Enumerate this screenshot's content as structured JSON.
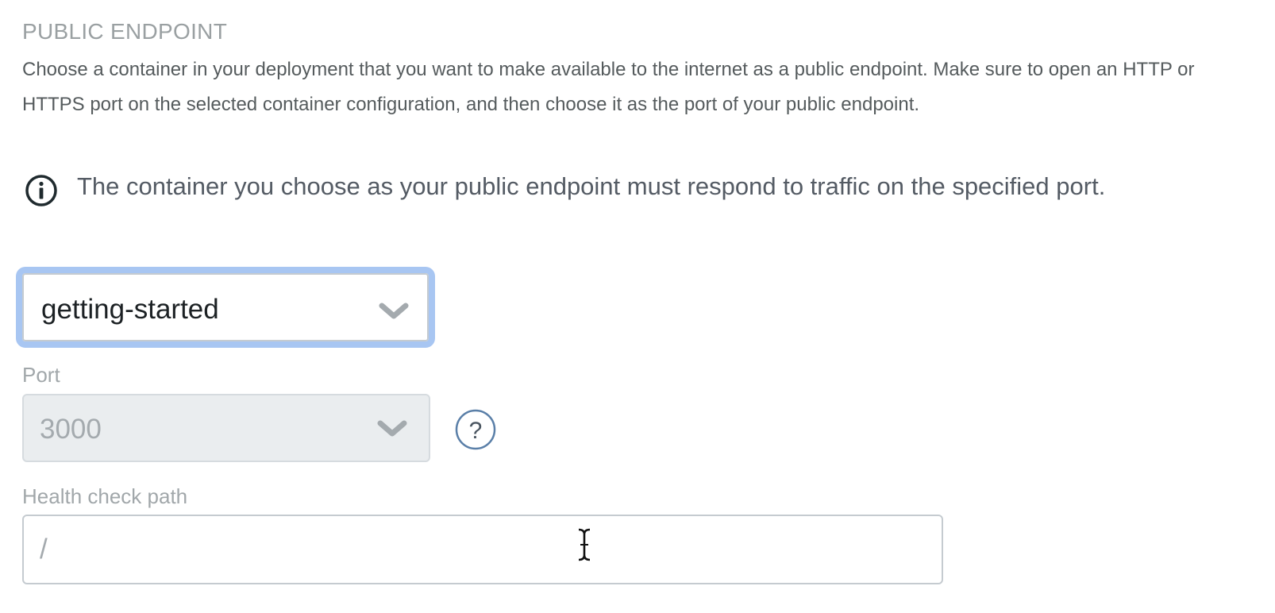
{
  "public_endpoint": {
    "heading": "PUBLIC ENDPOINT",
    "description": "Choose a container in your deployment that you want to make available to the internet as a public endpoint. Make sure to open an HTTP or HTTPS port on the selected container configuration, and then choose it as the port of your public endpoint.",
    "info_icon": "info-circle-icon",
    "info_text": "The container you choose as your public endpoint must respond to traffic on the specified port.",
    "container_select": {
      "value": "getting-started",
      "icon": "chevron-down-icon",
      "focused": true
    },
    "port": {
      "label": "Port",
      "value": "3000",
      "disabled": true,
      "icon": "chevron-down-icon",
      "help_icon": "question-circle-icon"
    },
    "health_check_path": {
      "label": "Health check path",
      "placeholder": "/",
      "value": ""
    }
  },
  "colors": {
    "focus_ring": "#a8c6f2",
    "border": "#c5cbd0",
    "disabled_bg": "#eaedef",
    "muted_text": "#a1a7aa",
    "help_icon": "#5a7fa8"
  }
}
